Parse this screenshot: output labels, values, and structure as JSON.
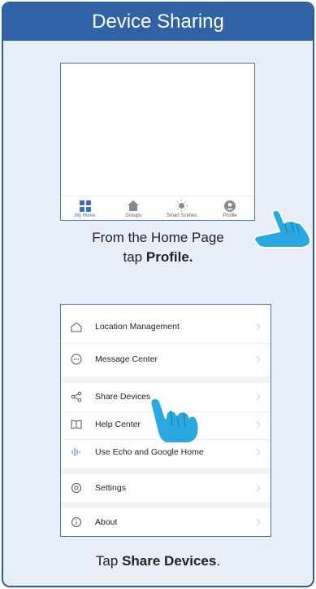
{
  "header": {
    "title": "Device Sharing"
  },
  "step1": {
    "tabs": [
      {
        "label": "My Home",
        "icon": "grid-icon",
        "active": true
      },
      {
        "label": "Groups",
        "icon": "house-icon",
        "active": false
      },
      {
        "label": "Smart Scenes",
        "icon": "sun-icon",
        "active": false
      },
      {
        "label": "Profile",
        "icon": "profile-icon",
        "active": false
      }
    ],
    "caption_line1": "From the Home Page",
    "caption_prefix": "tap",
    "caption_bold": "Profile."
  },
  "step2": {
    "menu": [
      {
        "label": "Location Management",
        "icon": "house-outline-icon"
      },
      {
        "label": "Message Center",
        "icon": "chat-bubble-icon"
      },
      {
        "label": "Share Devices",
        "icon": "share-icon"
      },
      {
        "label": "Help Center",
        "icon": "book-icon"
      },
      {
        "label": "Use Echo and Google Home",
        "icon": "sound-wave-icon"
      },
      {
        "label": "Settings",
        "icon": "settings-icon"
      },
      {
        "label": "About",
        "icon": "info-icon"
      }
    ],
    "caption_prefix": "Tap",
    "caption_bold": "Share Devices",
    "caption_suffix": "."
  },
  "colors": {
    "accent": "#2f63a6",
    "panel": "#e7eef7",
    "hand": "#2aa8e0"
  }
}
